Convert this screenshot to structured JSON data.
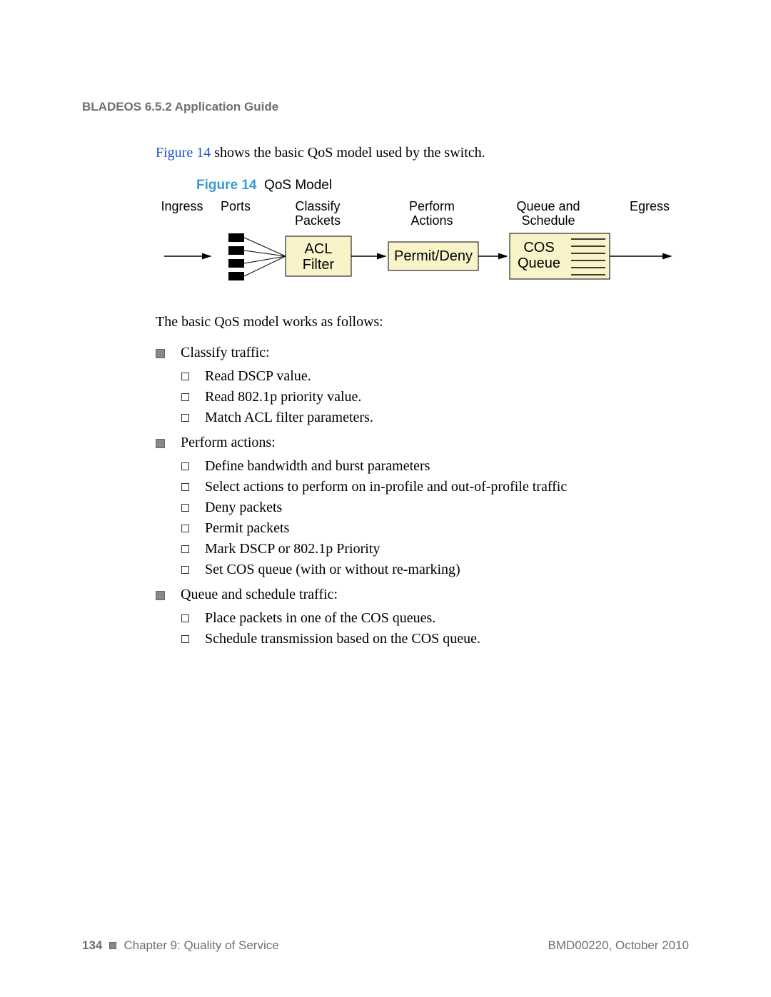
{
  "header": {
    "title": "BLADEOS 6.5.2 Application Guide"
  },
  "intro_sentence_prefix": "Figure 14",
  "intro_sentence_rest": " shows the basic QoS model used by the switch.",
  "figure": {
    "label": "Figure 14",
    "caption": "QoS Model",
    "labels": {
      "ingress": "Ingress",
      "ports": "Ports",
      "classify1": "Classify",
      "classify2": "Packets",
      "perform1": "Perform",
      "perform2": "Actions",
      "queue1": "Queue and",
      "queue2": "Schedule",
      "egress": "Egress"
    },
    "boxes": {
      "acl1": "ACL",
      "acl2": "Filter",
      "permit": "Permit/Deny",
      "cos1": "COS",
      "cos2": "Queue"
    }
  },
  "intro_line2": "The basic QoS model works as follows:",
  "bullets": [
    {
      "text": "Classify traffic:",
      "sub": [
        "Read DSCP value.",
        "Read 802.1p priority value.",
        "Match ACL filter parameters."
      ]
    },
    {
      "text": "Perform actions:",
      "sub": [
        "Define bandwidth and burst parameters",
        "Select actions to perform on in-profile and out-of-profile traffic",
        "Deny packets",
        "Permit packets",
        "Mark DSCP or 802.1p Priority",
        "Set COS queue (with or without re-marking)"
      ]
    },
    {
      "text": "Queue and schedule traffic:",
      "sub": [
        "Place packets in one of the COS queues.",
        "Schedule transmission based on the COS queue."
      ]
    }
  ],
  "footer": {
    "page_num": "134",
    "chapter": "Chapter 9: Quality of Service",
    "docref": "BMD00220, October 2010"
  }
}
